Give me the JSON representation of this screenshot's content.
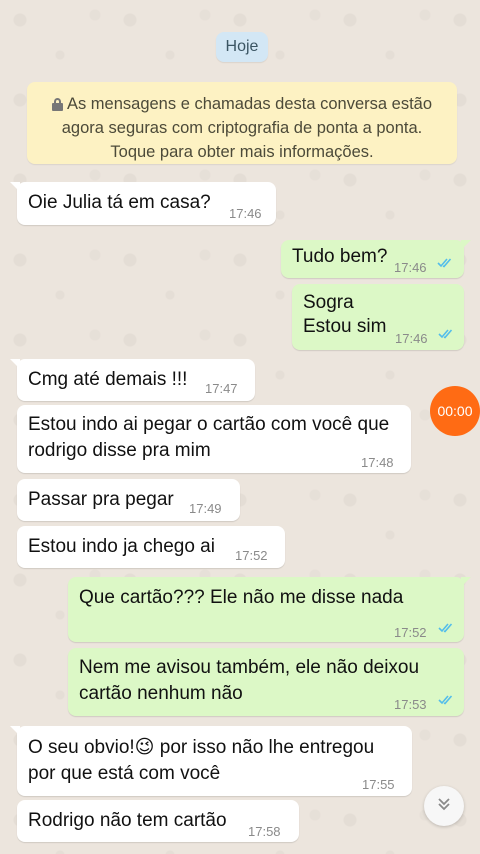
{
  "date_label": "Hoje",
  "encryption_notice": {
    "line1": "As mensagens e chamadas desta conversa estão",
    "line2": "agora seguras com criptografia de ponta a ponta.",
    "line3": "Toque para obter mais informações."
  },
  "messages": [
    {
      "dir": "in",
      "lines": [
        "Oie Julia tá em casa?"
      ],
      "time": "17:46"
    },
    {
      "dir": "out",
      "lines": [
        "Tudo bem?"
      ],
      "time": "17:46",
      "read": true
    },
    {
      "dir": "out",
      "lines": [
        "Sogra",
        "Estou sim"
      ],
      "time": "17:46",
      "read": true
    },
    {
      "dir": "in",
      "lines": [
        "Cmg até demais !!!"
      ],
      "time": "17:47"
    },
    {
      "dir": "in",
      "lines": [
        "Estou indo ai pegar o cartão com você que",
        "rodrigo disse pra mim"
      ],
      "time": "17:48"
    },
    {
      "dir": "in",
      "lines": [
        "Passar pra pegar"
      ],
      "time": "17:49"
    },
    {
      "dir": "in",
      "lines": [
        "Estou indo ja chego ai"
      ],
      "time": "17:52"
    },
    {
      "dir": "out",
      "lines": [
        "Que cartão??? Ele não me disse nada"
      ],
      "time": "17:52",
      "read": true
    },
    {
      "dir": "out",
      "lines": [
        "Nem me avisou também, ele não deixou",
        "cartão nenhum não"
      ],
      "time": "17:53",
      "read": true
    },
    {
      "dir": "in",
      "lines": [
        "O seu obvio!😉 por isso não lhe entregou",
        "por que está com você"
      ],
      "time": "17:55"
    },
    {
      "dir": "in",
      "lines": [
        "Rodrigo não tem cartão"
      ],
      "time": "17:58"
    }
  ],
  "call_badge": "00:00",
  "icons": {
    "lock": "lock-icon",
    "read": "double-check-icon",
    "scroll": "chevron-down-double-icon"
  },
  "colors": {
    "incoming": "#ffffff",
    "outgoing": "#dcf8c6",
    "read_ticks": "#53bdeb",
    "badge": "#ff6b14"
  }
}
